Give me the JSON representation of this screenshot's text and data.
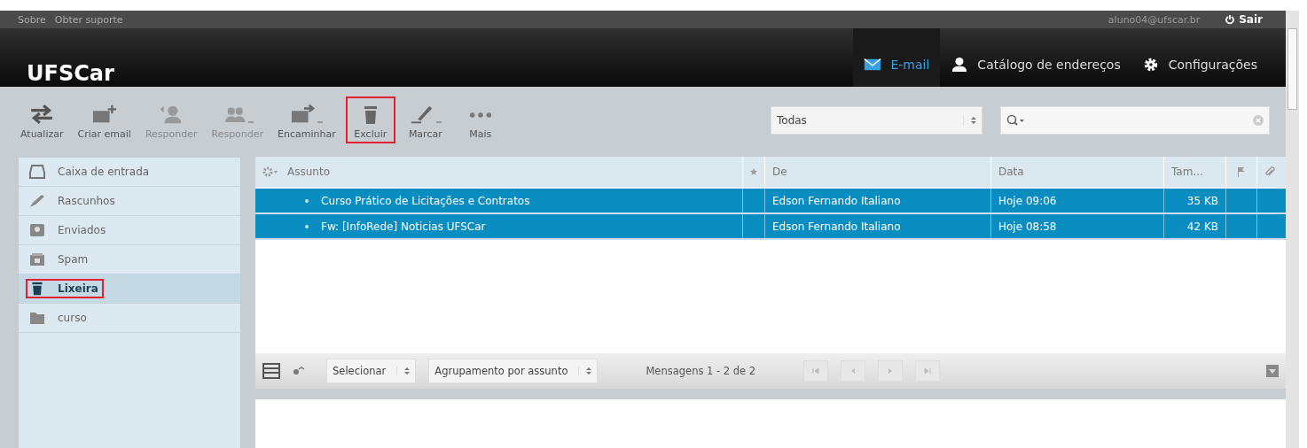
{
  "top_links": [
    "Sobre",
    "Obter suporte"
  ],
  "user": "aluno04@ufscar.br",
  "logout": "Sair",
  "logo": "UFSCar",
  "nav": [
    {
      "label": "E-mail",
      "kind": "mail",
      "selected": true
    },
    {
      "label": "Catálogo de endereços",
      "kind": "person",
      "selected": false
    },
    {
      "label": "Configurações",
      "kind": "gear",
      "selected": false
    }
  ],
  "toolbar": [
    {
      "label": "Atualizar",
      "kind": "refresh",
      "disabled": false,
      "highlighted": false,
      "menu": false
    },
    {
      "label": "Criar email",
      "kind": "compose",
      "disabled": false,
      "highlighted": false,
      "menu": false
    },
    {
      "label": "Responder",
      "kind": "reply",
      "disabled": true,
      "highlighted": false,
      "menu": false
    },
    {
      "label": "Responder",
      "kind": "replyall",
      "disabled": true,
      "highlighted": false,
      "menu": true
    },
    {
      "label": "Encaminhar",
      "kind": "forward",
      "disabled": false,
      "highlighted": false,
      "menu": true
    },
    {
      "label": "Excluir",
      "kind": "trash",
      "disabled": false,
      "highlighted": true,
      "menu": false
    },
    {
      "label": "Marcar",
      "kind": "pen",
      "disabled": false,
      "highlighted": false,
      "menu": true
    },
    {
      "label": "Mais",
      "kind": "dots",
      "disabled": false,
      "highlighted": false,
      "menu": false
    }
  ],
  "filter": {
    "value": "Todas"
  },
  "folders": [
    {
      "name": "Caixa de entrada",
      "kind": "inbox",
      "selected": false,
      "highlighted": false
    },
    {
      "name": "Rascunhos",
      "kind": "pen",
      "selected": false,
      "highlighted": false
    },
    {
      "name": "Enviados",
      "kind": "sent",
      "selected": false,
      "highlighted": false
    },
    {
      "name": "Spam",
      "kind": "spam",
      "selected": false,
      "highlighted": false
    },
    {
      "name": "Lixeira",
      "kind": "trash",
      "selected": true,
      "highlighted": true
    },
    {
      "name": "curso",
      "kind": "folder",
      "selected": false,
      "highlighted": false
    }
  ],
  "columns": {
    "subject": "Assunto",
    "from": "De",
    "date": "Data",
    "size": "Tam..."
  },
  "rows": [
    {
      "subject": "Curso Prático de Licitações e Contratos",
      "from": "Edson Fernando Italiano",
      "date": "Hoje 09:06",
      "size": "35 KB",
      "selected": true
    },
    {
      "subject": "Fw: [InfoRede] Noticias UFSCar",
      "from": "Edson Fernando Italiano",
      "date": "Hoje 08:58",
      "size": "42 KB",
      "selected": true
    }
  ],
  "footer": {
    "select": "Selecionar",
    "grouping": "Agrupamento por assunto",
    "count": "Mensagens 1 - 2 de 2"
  }
}
